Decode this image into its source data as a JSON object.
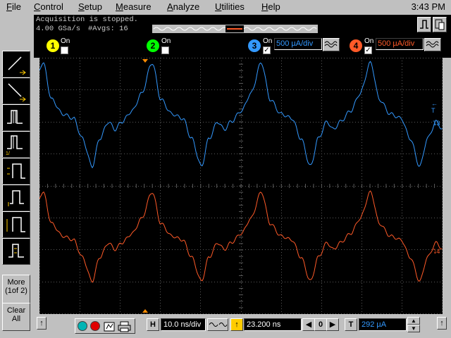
{
  "menu": {
    "items": [
      "File",
      "Control",
      "Setup",
      "Measure",
      "Analyze",
      "Utilities",
      "Help"
    ],
    "time": "3:43 PM"
  },
  "status": {
    "line1": "Acquisition is stopped.",
    "sample_rate": "4.00 GSa/s",
    "averages": "#Avgs: 16"
  },
  "toolbar": {
    "more_label": "More",
    "more_page": "(1of 2)",
    "clear_label": "Clear",
    "clear_label2": "All"
  },
  "channels": [
    {
      "num": "1",
      "on_label": "On",
      "checked": false,
      "color": "#ffff00"
    },
    {
      "num": "2",
      "on_label": "On",
      "checked": false,
      "color": "#00ff00"
    },
    {
      "num": "3",
      "on_label": "On",
      "checked": true,
      "color": "#3399ff",
      "scale": "500 µA/div"
    },
    {
      "num": "4",
      "on_label": "On",
      "checked": true,
      "color": "#ff5a28",
      "scale": "500 µA/div"
    }
  ],
  "display": {
    "trigger_label": "T",
    "ch3_marker": "3",
    "ch4_marker": "4",
    "trace_colors": {
      "ch3": "#3399ff",
      "ch4": "#ff5a28",
      "grid": "#5a5a5a"
    }
  },
  "bottom": {
    "h_label": "H",
    "timebase": "10.0 ns/div",
    "delay": "23.200 ns",
    "t_label": "T",
    "trigger_level": "292 µA",
    "delay_zero": "0"
  }
}
